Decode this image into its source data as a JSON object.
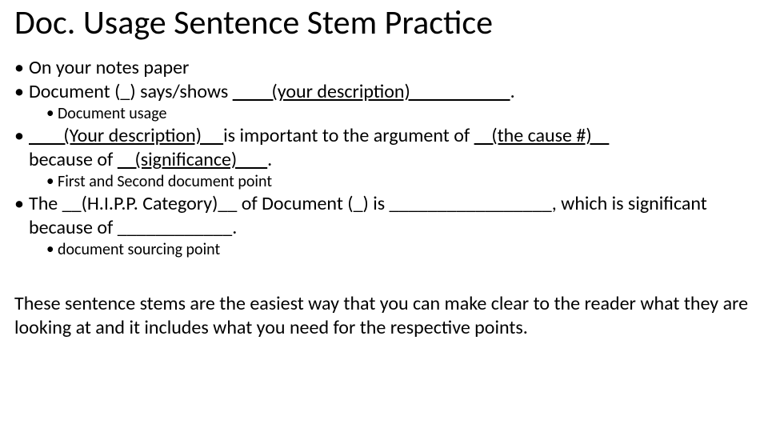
{
  "title": "Doc. Usage Sentence Stem Practice",
  "bullets": {
    "b1": "On your notes paper",
    "b2_prefix": "Document (_) says/shows ",
    "b2_u": "         (your description)                       ",
    "b2_suffix": ".",
    "b2_sub": "Document usage",
    "b3_u1": "        (Your description)     ",
    "b3_mid": "is important to the argument of ",
    "b3_u2": "    (the cause #)    ",
    "b3_line2_prefix": "because of ",
    "b3_u3": "    (significance)       ",
    "b3_line2_suffix": ".",
    "b3_sub": "First and Second document point",
    "b4": "The __(H.I.P.P. Category)__ of Document (_) is _________________, which is significant because of ____________.",
    "b4_sub": "document sourcing point"
  },
  "para": "These sentence stems are the easiest way that you can make clear to the reader what they are looking at and it includes what you need for the respective points."
}
